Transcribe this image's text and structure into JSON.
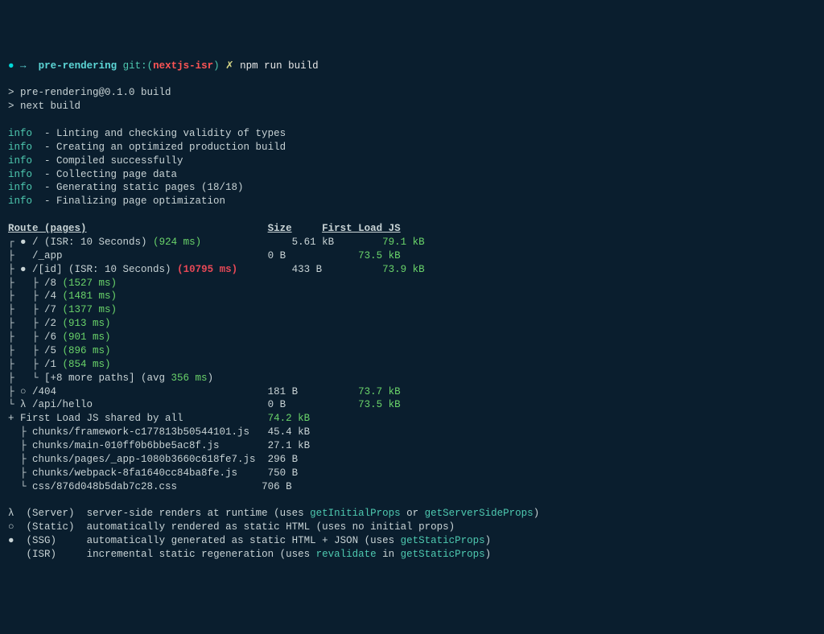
{
  "prompt": {
    "dot": "●",
    "arrow": "→",
    "dir": "pre-rendering",
    "git_label": "git:(",
    "branch": "nextjs-isr",
    "git_close": ")",
    "x": "✗",
    "command": "npm run build"
  },
  "header": {
    "line1": "> pre-rendering@0.1.0 build",
    "line2": "> next build"
  },
  "info_label": "info",
  "info_lines": [
    "  - Linting and checking validity of types",
    "  - Creating an optimized production build",
    "  - Compiled successfully",
    "  - Collecting page data",
    "  - Generating static pages (18/18)",
    "  - Finalizing page optimization"
  ],
  "table_header": {
    "route": "Route (pages)",
    "size": "Size",
    "first_load": "First Load JS"
  },
  "routes": {
    "root": {
      "prefix": "┌ ● ",
      "name": "/ (ISR: 10 Seconds)",
      "timing": "(924 ms)",
      "size": "5.61 kB",
      "fl": "79.1 kB"
    },
    "app": {
      "prefix": "├   ",
      "name": "/_app",
      "size": "0 B",
      "fl": "73.5 kB"
    },
    "id": {
      "prefix": "├ ● ",
      "name": "/[id] (ISR: 10 Seconds)",
      "timing": "(10795 ms)",
      "size": "433 B",
      "fl": "73.9 kB"
    },
    "id_children": [
      {
        "prefix": "├   ├ ",
        "name": "/8",
        "timing": "(1527 ms)"
      },
      {
        "prefix": "├   ├ ",
        "name": "/4",
        "timing": "(1481 ms)"
      },
      {
        "prefix": "├   ├ ",
        "name": "/7",
        "timing": "(1377 ms)"
      },
      {
        "prefix": "├   ├ ",
        "name": "/2",
        "timing": "(913 ms)"
      },
      {
        "prefix": "├   ├ ",
        "name": "/6",
        "timing": "(901 ms)"
      },
      {
        "prefix": "├   ├ ",
        "name": "/5",
        "timing": "(896 ms)"
      },
      {
        "prefix": "├   ├ ",
        "name": "/1",
        "timing": "(854 ms)"
      }
    ],
    "more": {
      "prefix": "├   └ ",
      "text": "[+8 more paths] (avg ",
      "timing": "356 ms",
      "close": ")"
    },
    "r404": {
      "prefix": "├ ○ ",
      "name": "/404",
      "size": "181 B",
      "fl": "73.7 kB"
    },
    "api": {
      "prefix": "└ λ ",
      "name": "/api/hello",
      "size": "0 B",
      "fl": "73.5 kB"
    },
    "shared": {
      "prefix": "+ ",
      "text": "First Load JS shared by all",
      "size": "74.2 kB"
    },
    "chunks": [
      {
        "prefix": "  ├ ",
        "name": "chunks/framework-c177813b50544101.js",
        "size": "45.4 kB"
      },
      {
        "prefix": "  ├ ",
        "name": "chunks/main-010ff0b6bbe5ac8f.js",
        "size": "27.1 kB"
      },
      {
        "prefix": "  ├ ",
        "name": "chunks/pages/_app-1080b3660c618fe7.js",
        "size": "296 B"
      },
      {
        "prefix": "  ├ ",
        "name": "chunks/webpack-8fa1640cc84ba8fe.js",
        "size": "750 B"
      },
      {
        "prefix": "  └ ",
        "name": "css/876d048b5dab7c28.css",
        "size": "706 B"
      }
    ]
  },
  "legend": {
    "server": {
      "sym": "λ",
      "label": "(Server)",
      "desc": "server-side renders at runtime (uses ",
      "h1": "getInitialProps",
      "mid": " or ",
      "h2": "getServerSideProps",
      "end": ")"
    },
    "static": {
      "sym": "○",
      "label": "(Static)",
      "desc": "automatically rendered as static HTML (uses no initial props)"
    },
    "ssg": {
      "sym": "●",
      "label": "(SSG)",
      "desc": "automatically generated as static HTML + JSON (uses ",
      "h1": "getStaticProps",
      "end": ")"
    },
    "isr": {
      "sym": " ",
      "label": "(ISR)",
      "desc": "incremental static regeneration (uses ",
      "h1": "revalidate",
      "mid": " in ",
      "h2": "getStaticProps",
      "end": ")"
    }
  }
}
